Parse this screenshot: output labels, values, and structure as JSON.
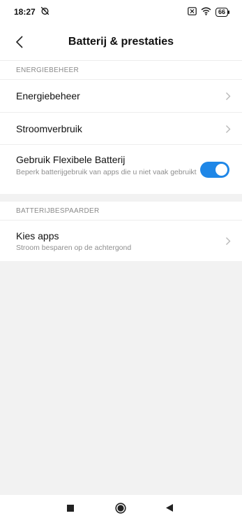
{
  "status_bar": {
    "time": "18:27",
    "battery_level": "66",
    "icons": [
      "alarm-off-icon",
      "sim-x-icon",
      "wifi-icon",
      "battery-icon"
    ]
  },
  "header": {
    "title": "Batterij & prestaties",
    "back_icon": "chevron-left-icon"
  },
  "section_power": {
    "label": "ENERGIEBEHEER",
    "items": [
      {
        "label": "Energiebeheer"
      },
      {
        "label": "Stroomverbruik"
      }
    ],
    "toggle_item": {
      "label": "Gebruik Flexibele Batterij",
      "subtitle": "Beperk batterijgebruik van apps die u niet vaak gebruikt",
      "enabled": true
    }
  },
  "section_saver": {
    "label": "BATTERIJBESPAARDER",
    "items": [
      {
        "label": "Kies apps",
        "subtitle": "Stroom besparen op de achtergond"
      }
    ]
  },
  "navigation": {
    "buttons": [
      "recents-square-icon",
      "home-circle-icon",
      "back-triangle-icon"
    ]
  },
  "colors": {
    "accent": "#1f87e7",
    "background": "#f2f2f2",
    "surface": "#ffffff"
  }
}
